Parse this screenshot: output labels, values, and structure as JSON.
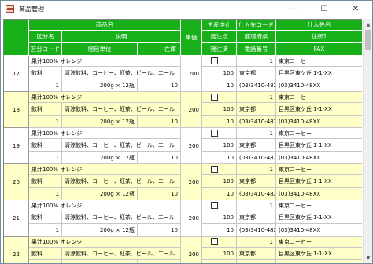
{
  "window": {
    "title": "商品管理",
    "minimize": "—",
    "maximize": "☐",
    "close": "✕"
  },
  "header": {
    "product_name": "商品名",
    "category": "区分名",
    "description": "説明",
    "category_code": "区分コード",
    "packing_unit": "梱包単位",
    "stock": "在庫",
    "unit_price": "単価",
    "discontinued": "生産中止",
    "ordering_point": "発注点",
    "ordered": "発注済",
    "supplier_code": "仕入先コード",
    "prefecture": "都道府県",
    "phone": "電話番号",
    "supplier_name": "仕入先名",
    "address1": "住所1",
    "fax": "FAX"
  },
  "rows": [
    {
      "num": "17",
      "name": "果汁100% オレンジ",
      "category": "飲料",
      "description": "清涼飲料、コーヒー、紅茶、ビール、エール",
      "code": "1",
      "unit": "200g × 12瓶",
      "stock": "10",
      "price": "200",
      "point": "100",
      "ordered": "10",
      "supplier_code": "1",
      "prefecture": "東京都",
      "phone": "(03)3410-48XX",
      "supplier": "東京コーヒー",
      "address": "目黒区東ケ丘 1-1-XX",
      "fax": "(03)3410-48XX",
      "highlight": false
    },
    {
      "num": "18",
      "name": "果汁100% オレンジ",
      "category": "飲料",
      "description": "清涼飲料、コーヒー、紅茶、ビール、エール",
      "code": "1",
      "unit": "200g × 12瓶",
      "stock": "10",
      "price": "200",
      "point": "100",
      "ordered": "10",
      "supplier_code": "1",
      "prefecture": "東京都",
      "phone": "(03)3410-48XX",
      "supplier": "東京コーヒー",
      "address": "目黒区東ケ丘 1-1-XX",
      "fax": "(03)3410-48XX",
      "highlight": true
    },
    {
      "num": "19",
      "name": "果汁100% オレンジ",
      "category": "飲料",
      "description": "清涼飲料、コーヒー、紅茶、ビール、エール",
      "code": "1",
      "unit": "200g × 12瓶",
      "stock": "10",
      "price": "200",
      "point": "100",
      "ordered": "10",
      "supplier_code": "1",
      "prefecture": "東京都",
      "phone": "(03)3410-48XX",
      "supplier": "東京コーヒー",
      "address": "目黒区東ケ丘 1-1-XX",
      "fax": "(03)3410-48XX",
      "highlight": false
    },
    {
      "num": "20",
      "name": "果汁100% オレンジ",
      "category": "飲料",
      "description": "清涼飲料、コーヒー、紅茶、ビール、エール",
      "code": "1",
      "unit": "200g × 12瓶",
      "stock": "10",
      "price": "200",
      "point": "100",
      "ordered": "10",
      "supplier_code": "1",
      "prefecture": "東京都",
      "phone": "(03)3410-48XX",
      "supplier": "東京コーヒー",
      "address": "目黒区東ケ丘 1-1-XX",
      "fax": "(03)3410-48XX",
      "highlight": true
    },
    {
      "num": "21",
      "name": "果汁100% オレンジ",
      "category": "飲料",
      "description": "清涼飲料、コーヒー、紅茶、ビール、エール",
      "code": "1",
      "unit": "200g × 12瓶",
      "stock": "10",
      "price": "200",
      "point": "100",
      "ordered": "10",
      "supplier_code": "1",
      "prefecture": "東京都",
      "phone": "(03)3410-48XX",
      "supplier": "東京コーヒー",
      "address": "目黒区東ケ丘 1-1-XX",
      "fax": "(03)3410-48XX",
      "highlight": false
    },
    {
      "num": "22",
      "name": "果汁100% オレンジ",
      "category": "飲料",
      "description": "清涼飲料、コーヒー、紅茶、ビール、エール",
      "code": "1",
      "unit": "200g × 12瓶",
      "stock": "10",
      "price": "200",
      "point": "100",
      "ordered": "10",
      "supplier_code": "1",
      "prefecture": "東京都",
      "phone": "(03)3410-48XX",
      "supplier": "東京コーヒー",
      "address": "目黒区東ケ丘 1-1-XX",
      "fax": "(03)3410-48XX",
      "highlight": true
    }
  ],
  "colors": {
    "header_green": "#18b018",
    "row_highlight": "#ffffc8",
    "row_plain": "#ffffff"
  },
  "icons": {
    "app": "app-icon",
    "scroll_up": "chevron-up-icon",
    "scroll_down": "chevron-down-icon"
  }
}
